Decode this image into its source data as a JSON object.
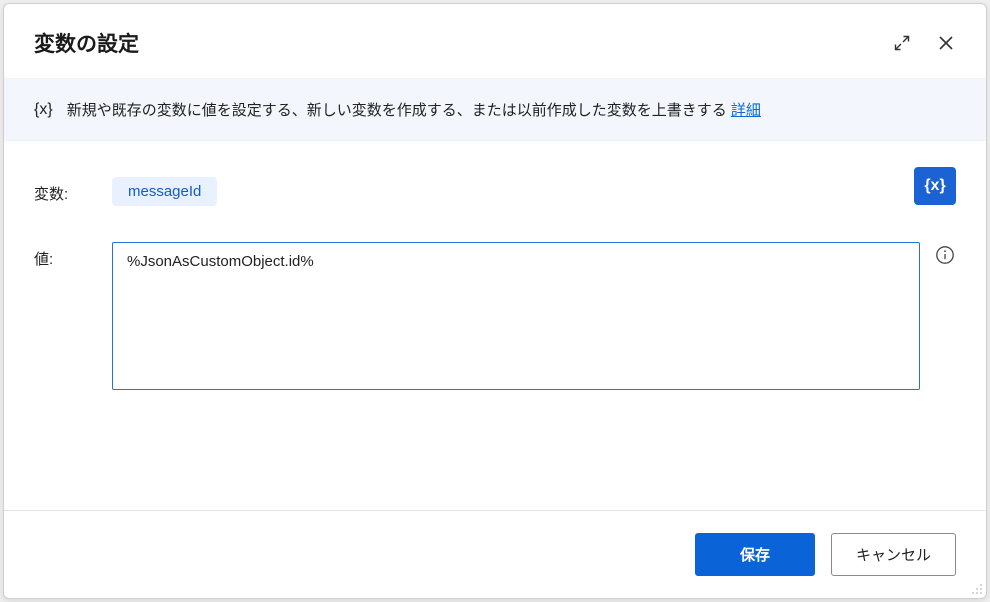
{
  "header": {
    "title": "変数の設定"
  },
  "info": {
    "icon_label": "{x}",
    "text": "新規や既存の変数に値を設定する、新しい変数を作成する、または以前作成した変数を上書きする ",
    "link": "詳細"
  },
  "fields": {
    "variable_label": "変数:",
    "variable_chip": "messageId",
    "value_label": "値:",
    "value_text": "%JsonAsCustomObject.id%",
    "fx_badge": "{x}"
  },
  "footer": {
    "save": "保存",
    "cancel": "キャンセル"
  }
}
